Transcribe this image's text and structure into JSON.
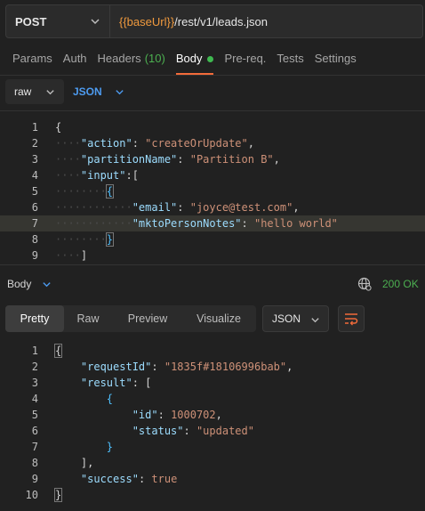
{
  "request": {
    "method": "POST",
    "url_variable": "{{baseUrl}}",
    "url_path": "/rest/v1/leads.json"
  },
  "tabs": [
    {
      "label": "Params"
    },
    {
      "label": "Auth"
    },
    {
      "label": "Headers",
      "count": "(10)"
    },
    {
      "label": "Body"
    },
    {
      "label": "Pre-req."
    },
    {
      "label": "Tests"
    },
    {
      "label": "Settings"
    }
  ],
  "body_mode": "raw",
  "body_format": "JSON",
  "request_body": [
    {
      "num": "1",
      "html": "<span class='p'>{</span>"
    },
    {
      "num": "2",
      "html": "<span class='ws'>····</span><span class='k'>\"action\"</span><span class='p'>: </span><span class='s'>\"createOrUpdate\"</span><span class='p'>,</span>"
    },
    {
      "num": "3",
      "html": "<span class='ws'>····</span><span class='k'>\"partitionName\"</span><span class='p'>: </span><span class='s'>\"Partition B\"</span><span class='p'>,</span>"
    },
    {
      "num": "4",
      "html": "<span class='ws'>····</span><span class='k'>\"input\"</span><span class='p'>:[</span>"
    },
    {
      "num": "5",
      "html": "<span class='ws'>········</span><span class='b brk'>{</span>"
    },
    {
      "num": "6",
      "html": "<span class='ws'>········</span><span class='ws'>····</span><span class='k'>\"email\"</span><span class='p'>: </span><span class='s'>\"joyce@test.com\"</span><span class='p'>,</span>"
    },
    {
      "num": "7",
      "html": "<span class='ws'>········</span><span class='ws'>····</span><span class='k'>\"mktoPersonNotes\"</span><span class='p'>: </span><span class='s'>\"hello world\"</span>",
      "highlight": true
    },
    {
      "num": "8",
      "html": "<span class='ws'>········</span><span class='b brk'>}</span>"
    },
    {
      "num": "9",
      "html": "<span class='ws'>····</span><span class='p'>]</span>"
    }
  ],
  "response": {
    "label": "Body",
    "status": "200 OK",
    "views": [
      "Pretty",
      "Raw",
      "Preview",
      "Visualize"
    ],
    "format": "JSON"
  },
  "response_body": [
    {
      "num": "1",
      "html": "<span class='p brk'>{</span>"
    },
    {
      "num": "2",
      "html": "    <span class='k'>\"requestId\"</span><span class='p'>: </span><span class='s'>\"1835f#18106996bab\"</span><span class='p'>,</span>"
    },
    {
      "num": "3",
      "html": "    <span class='k'>\"result\"</span><span class='p'>: [</span>"
    },
    {
      "num": "4",
      "html": "        <span class='b'>{</span>"
    },
    {
      "num": "5",
      "html": "            <span class='k'>\"id\"</span><span class='p'>: </span><span class='s'>1000702</span><span class='p'>,</span>"
    },
    {
      "num": "6",
      "html": "            <span class='k'>\"status\"</span><span class='p'>: </span><span class='s'>\"updated\"</span>"
    },
    {
      "num": "7",
      "html": "        <span class='b'>}</span>"
    },
    {
      "num": "8",
      "html": "    <span class='p'>],</span>"
    },
    {
      "num": "9",
      "html": "    <span class='k'>\"success\"</span><span class='p'>: </span><span class='s'>true</span>"
    },
    {
      "num": "10",
      "html": "<span class='p brk'>}</span>"
    }
  ],
  "colors": {
    "accent": "#f26b3a",
    "status_ok": "#4caf50",
    "link_blue": "#4d9bf0",
    "variable": "#f09a3e"
  },
  "icons": [
    "chevron-down-icon",
    "globe-icon",
    "wrap-lines-icon"
  ]
}
